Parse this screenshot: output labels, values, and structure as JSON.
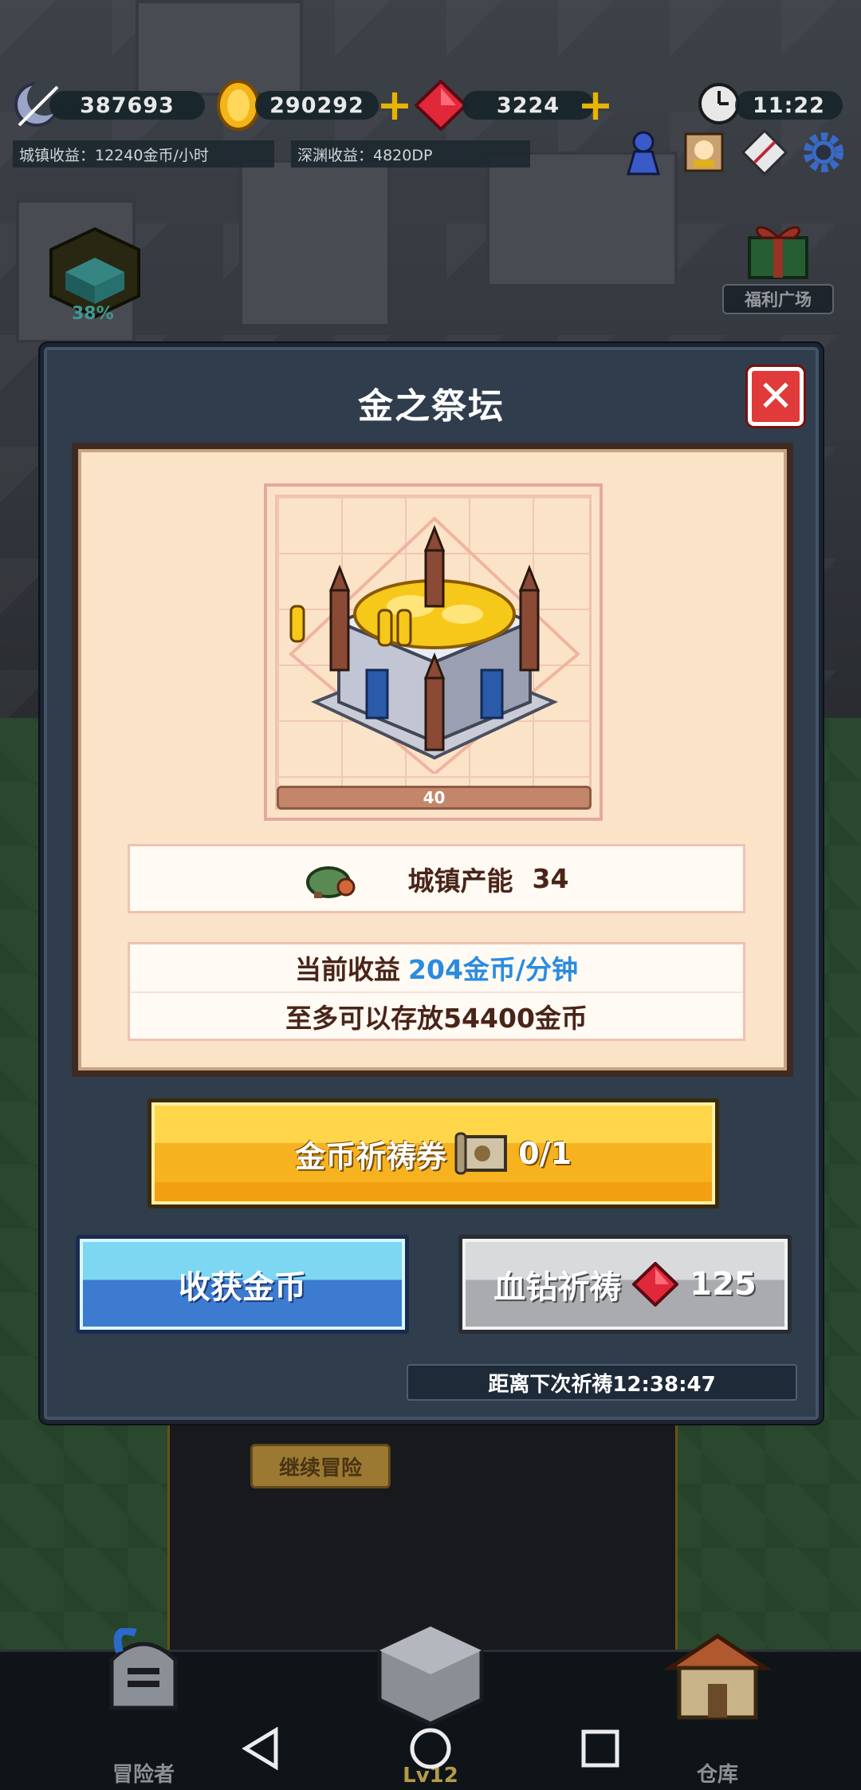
{
  "hud": {
    "stamina_value": "387693",
    "gold_value": "290292",
    "gem_value": "3224",
    "clock_value": "11:22",
    "town_income": "城镇收益：12240金币/小时",
    "abyss_income": "深渊收益：4820DP"
  },
  "world": {
    "progress_percent": "38%",
    "welfare_label": "福利广场",
    "continue_label": "继续冒险"
  },
  "modal": {
    "title": "金之祭坛",
    "building_level": "40",
    "production_label": "城镇产能",
    "production_value": "34",
    "income_prefix": "当前收益",
    "income_value": "204金币/分钟",
    "storage_text": "至多可以存放54400金币",
    "prayer_ticket_label": "金币祈祷券",
    "prayer_ticket_count": "0/1",
    "harvest_label": "收获金币",
    "blood_prayer_label": "血钻祈祷",
    "blood_prayer_cost": "125",
    "timer_text": "距离下次祈祷12:38:47"
  },
  "bottom_tabs": {
    "adventurer": "冒险者",
    "main_city_level": "Lv12",
    "warehouse": "仓库"
  },
  "colors": {
    "modal_bg": "#2f3d4c",
    "card_bg": "#fbe3c8",
    "income_accent": "#2a8be0",
    "close_red": "#e03a3a",
    "gold_button": "#f7b21f",
    "blue_button": "#3d7bd1"
  }
}
